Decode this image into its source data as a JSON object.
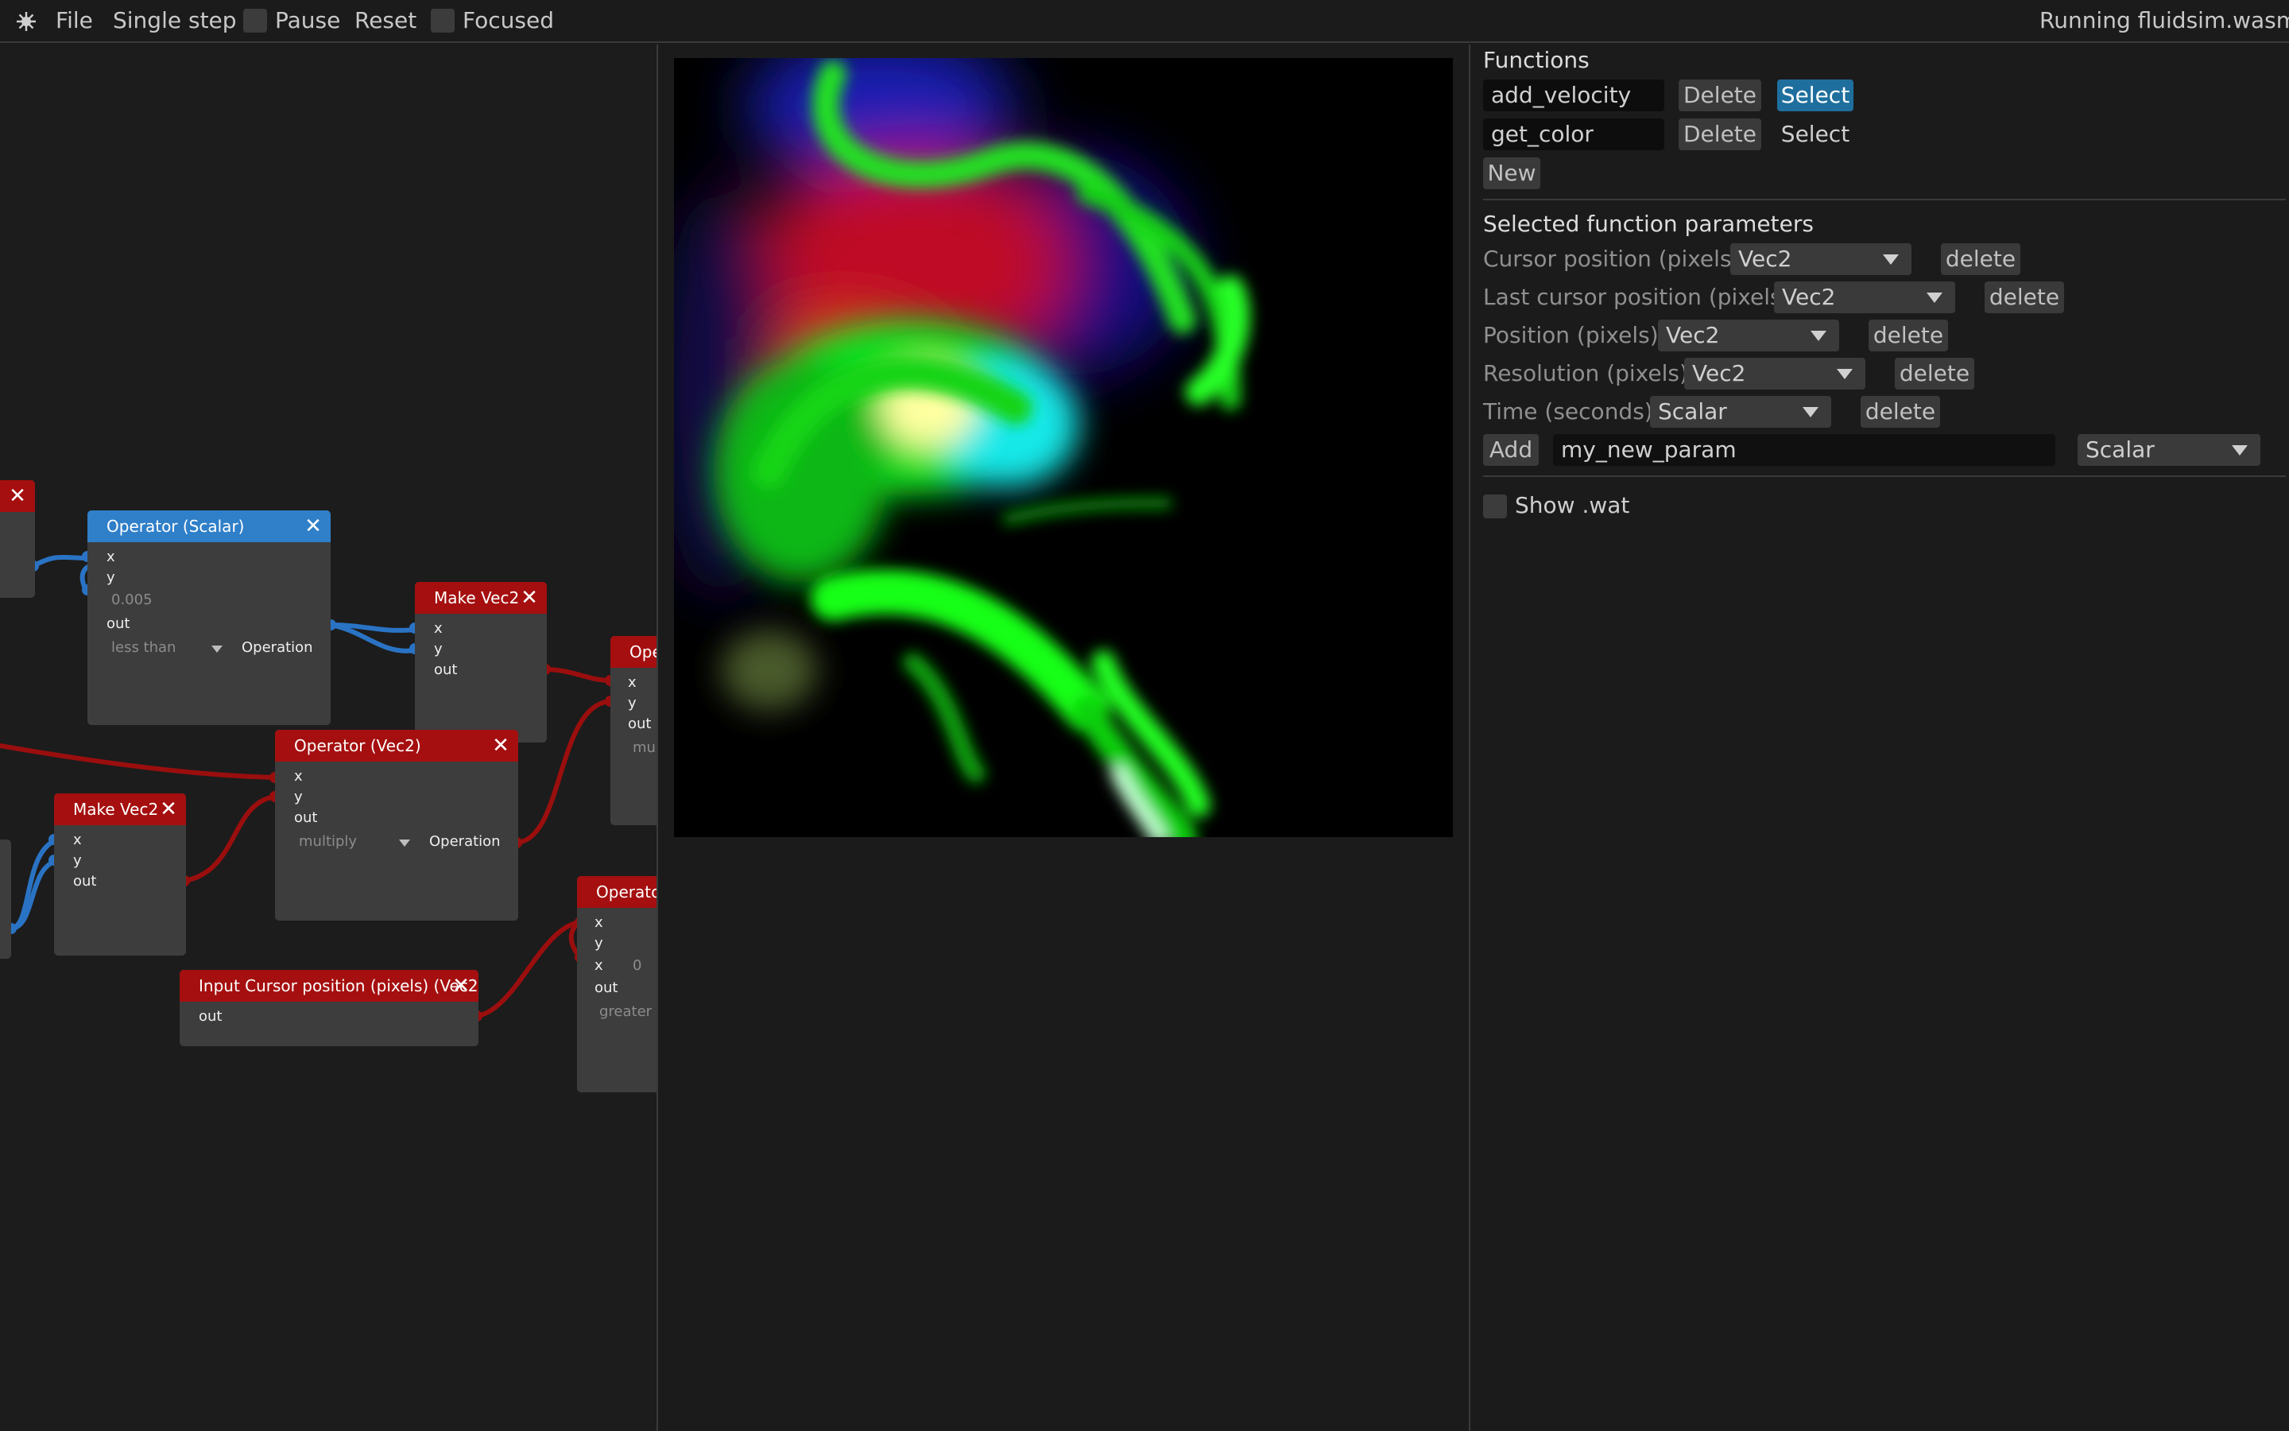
{
  "menu": {
    "file": "File",
    "single_step": "Single step",
    "pause": "Pause",
    "reset": "Reset",
    "focused": "Focused",
    "status": "Running fluidsim.wasm",
    "icon": "gear-icon"
  },
  "nodes": {
    "op_scalar": {
      "title": "Operator (Scalar)",
      "x": "x",
      "y": "y",
      "value": "0.005",
      "out": "out",
      "operation_value": "less than",
      "operation_label": "Operation"
    },
    "make_vec2_a": {
      "title": "Make Vec2",
      "x": "x",
      "y": "y",
      "out": "out"
    },
    "op_partial_top": {
      "title": "Oper",
      "x": "x",
      "y": "y",
      "out": "out",
      "operation_value": "mul"
    },
    "op_vec2": {
      "title": "Operator (Vec2)",
      "x": "x",
      "y": "y",
      "out": "out",
      "operation_value": "multiply",
      "operation_label": "Operation"
    },
    "make_vec2_b": {
      "title": "Make Vec2",
      "x": "x",
      "y": "y",
      "out": "out"
    },
    "input_cursor": {
      "title": "Input Cursor position (pixels) (Vec2)",
      "out": "out"
    },
    "op_partial_bottom": {
      "title": "Operator",
      "x": "x",
      "y": "y",
      "x2": "x",
      "x2_value": "0",
      "out": "out",
      "operation_value": "greater"
    },
    "close_glyph": "✕"
  },
  "functions": {
    "heading": "Functions",
    "items": [
      {
        "name": "add_velocity",
        "delete": "Delete",
        "select": "Select",
        "selected": true
      },
      {
        "name": "get_color",
        "delete": "Delete",
        "select": "Select",
        "selected": false
      }
    ],
    "new_label": "New"
  },
  "parameters": {
    "heading": "Selected function parameters",
    "items": [
      {
        "label": "Cursor position (pixels)",
        "type": "Vec2",
        "delete": "delete"
      },
      {
        "label": "Last cursor position (pixels)",
        "type": "Vec2",
        "delete": "delete"
      },
      {
        "label": "Position (pixels)",
        "type": "Vec2",
        "delete": "delete"
      },
      {
        "label": "Resolution (pixels)",
        "type": "Vec2",
        "delete": "delete"
      },
      {
        "label": "Time (seconds)",
        "type": "Scalar",
        "delete": "delete"
      }
    ],
    "add_label": "Add",
    "new_param_value": "my_new_param",
    "new_param_type": "Scalar"
  },
  "show_wat": "Show .wat",
  "colors": {
    "wire_blue": "#2a73c4",
    "wire_red": "#9a0e0e",
    "header_blue": "#2f7fc9",
    "header_red": "#a50f0f",
    "select_active": "#1f6f9e"
  }
}
